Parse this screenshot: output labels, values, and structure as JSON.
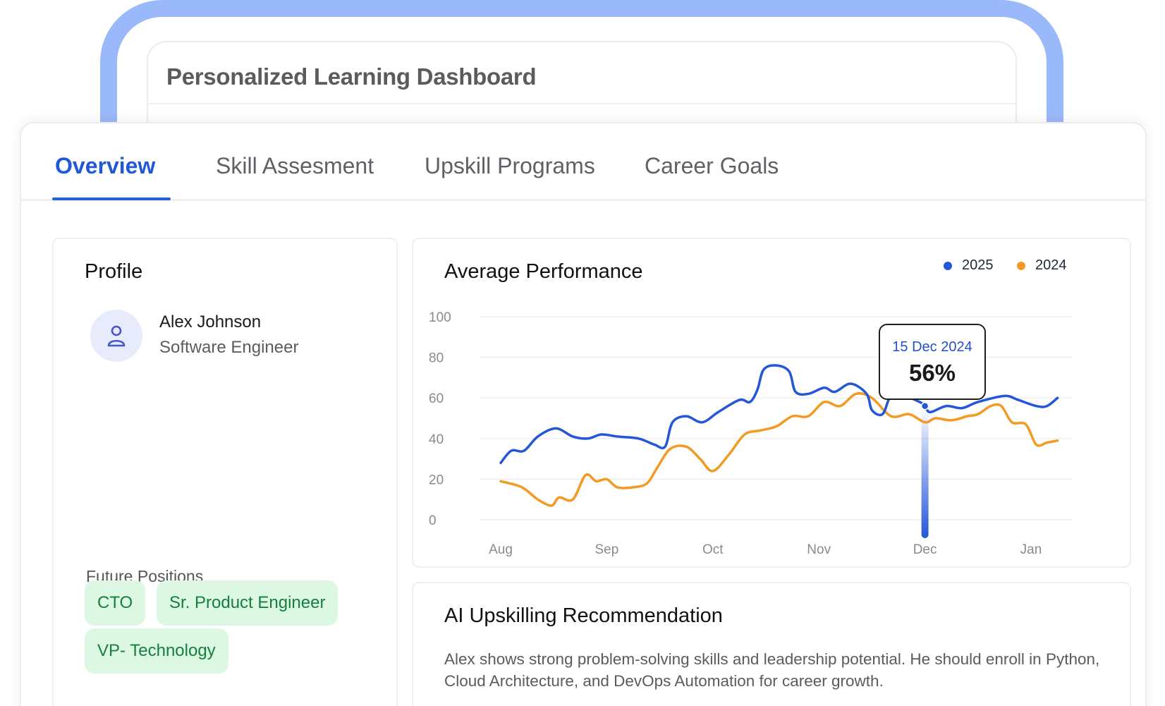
{
  "background_window": {
    "title": "Personalized Learning Dashboard"
  },
  "tabs": [
    {
      "label": "Overview",
      "active": true
    },
    {
      "label": "Skill Assesment",
      "active": false
    },
    {
      "label": "Upskill Programs",
      "active": false
    },
    {
      "label": "Career Goals",
      "active": false
    }
  ],
  "profile": {
    "title": "Profile",
    "avatar_icon": "user-icon",
    "name": "Alex Johnson",
    "role": "Software Engineer",
    "future_positions_label": "Future Positions",
    "future_positions": [
      "CTO",
      "Sr. Product Engineer",
      "VP- Technology"
    ]
  },
  "chart": {
    "title": "Average Performance",
    "tooltip": {
      "date": "15 Dec 2024",
      "value": "56%"
    }
  },
  "chart_data": {
    "type": "line",
    "title": "Average Performance",
    "x_ticks": [
      "Aug",
      "Sep",
      "Oct",
      "Nov",
      "Dec",
      "Jan"
    ],
    "y_ticks": [
      0,
      20,
      40,
      60,
      80,
      100
    ],
    "ylim": [
      0,
      100
    ],
    "grid": true,
    "legend_position": "top-right",
    "highlight": {
      "series": "2025",
      "date": "15 Dec 2024",
      "value": 56
    },
    "series": [
      {
        "name": "2025",
        "color": "#2456d8",
        "points": [
          [
            0,
            28
          ],
          [
            0.1,
            34
          ],
          [
            0.22,
            34
          ],
          [
            0.35,
            41
          ],
          [
            0.52,
            45
          ],
          [
            0.68,
            41
          ],
          [
            0.82,
            40
          ],
          [
            0.95,
            42
          ],
          [
            1.1,
            41
          ],
          [
            1.3,
            40
          ],
          [
            1.45,
            37
          ],
          [
            1.55,
            36
          ],
          [
            1.62,
            48
          ],
          [
            1.75,
            51
          ],
          [
            1.9,
            48
          ],
          [
            2.05,
            53
          ],
          [
            2.25,
            59
          ],
          [
            2.35,
            58
          ],
          [
            2.42,
            64
          ],
          [
            2.48,
            74
          ],
          [
            2.6,
            76
          ],
          [
            2.72,
            73
          ],
          [
            2.78,
            63
          ],
          [
            2.9,
            62
          ],
          [
            3.05,
            65
          ],
          [
            3.15,
            63
          ],
          [
            3.3,
            67
          ],
          [
            3.45,
            62
          ],
          [
            3.5,
            54
          ],
          [
            3.6,
            52
          ],
          [
            3.68,
            61
          ],
          [
            3.8,
            61
          ],
          [
            3.95,
            58
          ],
          [
            4.0,
            56
          ],
          [
            4.05,
            53
          ],
          [
            4.2,
            56
          ],
          [
            4.35,
            55
          ],
          [
            4.5,
            58
          ],
          [
            4.75,
            61
          ],
          [
            4.88,
            59
          ],
          [
            5.05,
            56
          ],
          [
            5.15,
            56
          ],
          [
            5.25,
            60
          ]
        ]
      },
      {
        "name": "2024",
        "color": "#f29a24",
        "points": [
          [
            0,
            19
          ],
          [
            0.2,
            16
          ],
          [
            0.35,
            10
          ],
          [
            0.48,
            7
          ],
          [
            0.55,
            11
          ],
          [
            0.68,
            10
          ],
          [
            0.8,
            22
          ],
          [
            0.9,
            19
          ],
          [
            1.0,
            20
          ],
          [
            1.1,
            16
          ],
          [
            1.25,
            16
          ],
          [
            1.38,
            18
          ],
          [
            1.48,
            26
          ],
          [
            1.6,
            35
          ],
          [
            1.75,
            36
          ],
          [
            1.88,
            30
          ],
          [
            2.0,
            24
          ],
          [
            2.15,
            32
          ],
          [
            2.3,
            42
          ],
          [
            2.45,
            44
          ],
          [
            2.6,
            46
          ],
          [
            2.75,
            51
          ],
          [
            2.9,
            51
          ],
          [
            3.05,
            58
          ],
          [
            3.2,
            56
          ],
          [
            3.35,
            62
          ],
          [
            3.5,
            60
          ],
          [
            3.68,
            51
          ],
          [
            3.85,
            52
          ],
          [
            4.0,
            48
          ],
          [
            4.1,
            50
          ],
          [
            4.25,
            49
          ],
          [
            4.4,
            51
          ],
          [
            4.5,
            52
          ],
          [
            4.62,
            56
          ],
          [
            4.72,
            56
          ],
          [
            4.82,
            48
          ],
          [
            4.95,
            47
          ],
          [
            5.05,
            37
          ],
          [
            5.15,
            38
          ],
          [
            5.25,
            39
          ]
        ]
      }
    ]
  },
  "ai": {
    "title": "AI Upskilling Recommendation",
    "text": "Alex shows strong problem-solving skills and leadership potential. He should enroll in Python, Cloud Architecture, and DevOps Automation for career growth."
  }
}
